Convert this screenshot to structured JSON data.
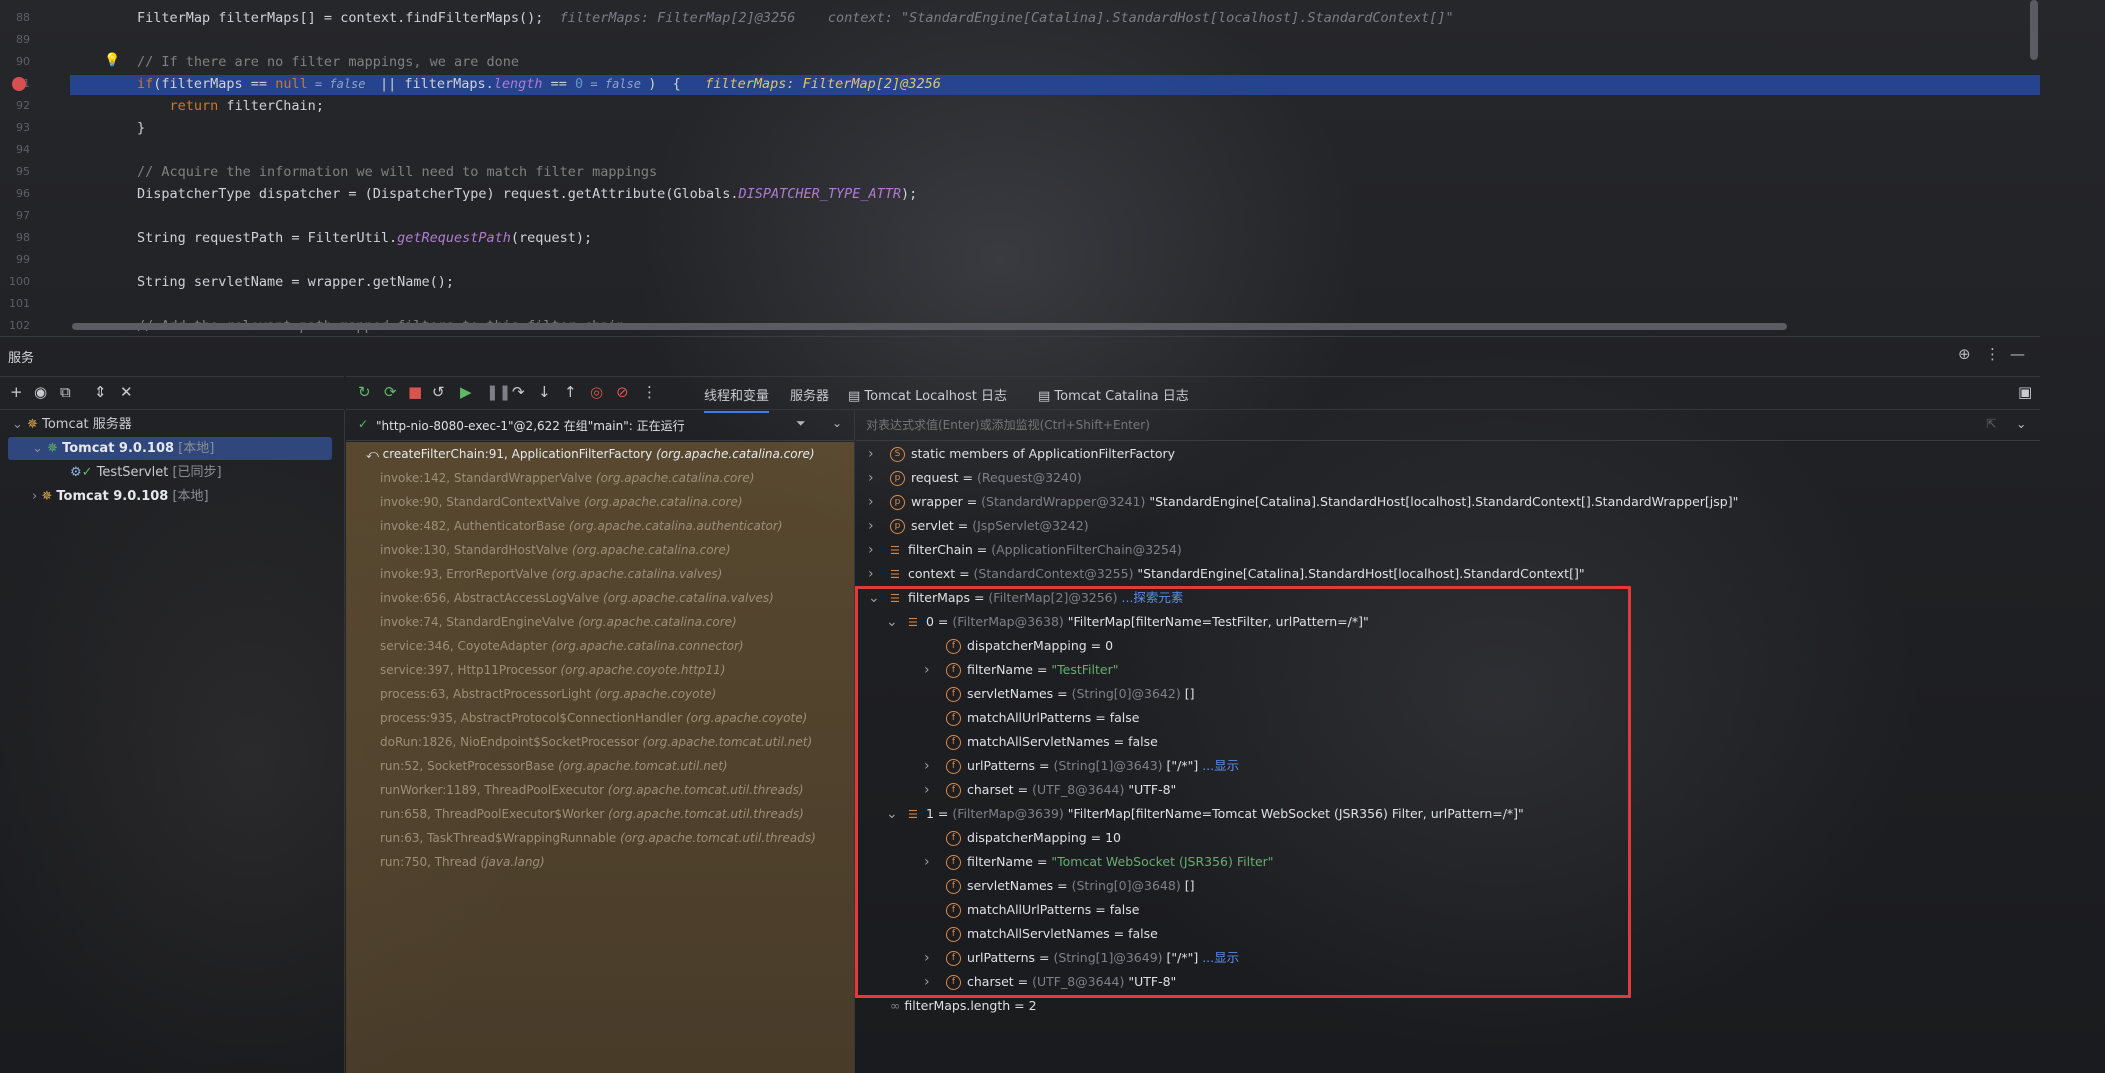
{
  "editor": {
    "lines": [
      {
        "num": "88",
        "html_segments": [
          [
            "",
            "FilterMap filterMaps[] = context.findFilterMaps();  "
          ],
          [
            "hint",
            "filterMaps: FilterMap[2]@3256    context: \"StandardEngine[Catalina].StandardHost[localhost].StandardContext[]\""
          ]
        ]
      },
      {
        "num": "89",
        "html_segments": []
      },
      {
        "num": "90",
        "html_segments": [
          [
            "cm",
            "// If there are no filter mappings, we are done"
          ]
        ]
      },
      {
        "num": "91",
        "html_segments": [
          [
            "kw",
            "if"
          ],
          [
            "",
            "(filterMaps == "
          ],
          [
            "kw",
            "null"
          ],
          [
            "inl-hint",
            " = false  "
          ],
          [
            "",
            "|| filterMaps."
          ],
          [
            "it",
            "length"
          ],
          [
            "",
            " == "
          ],
          [
            "num",
            "0"
          ],
          [
            "inl-hint",
            " = false "
          ],
          [
            "",
            ")  {   "
          ],
          [
            "fn",
            "filterMaps: FilterMap[2]@3256"
          ]
        ]
      },
      {
        "num": "92",
        "html_segments": [
          [
            "kw",
            "    return"
          ],
          [
            "",
            " filterChain;"
          ]
        ]
      },
      {
        "num": "93",
        "html_segments": [
          [
            "",
            "}"
          ]
        ]
      },
      {
        "num": "94",
        "html_segments": []
      },
      {
        "num": "95",
        "html_segments": [
          [
            "cm",
            "// Acquire the information we will need to match filter mappings"
          ]
        ]
      },
      {
        "num": "96",
        "html_segments": [
          [
            "",
            "DispatcherType dispatcher = (DispatcherType) request.getAttribute(Globals."
          ],
          [
            "it",
            "DISPATCHER_TYPE_ATTR"
          ],
          [
            "",
            ");"
          ]
        ]
      },
      {
        "num": "97",
        "html_segments": []
      },
      {
        "num": "98",
        "html_segments": [
          [
            "",
            "String requestPath = FilterUtil."
          ],
          [
            "it",
            "getRequestPath"
          ],
          [
            "",
            "(request);"
          ]
        ]
      },
      {
        "num": "99",
        "html_segments": []
      },
      {
        "num": "100",
        "html_segments": [
          [
            "",
            "String servletName = wrapper.getName();"
          ]
        ]
      },
      {
        "num": "101",
        "html_segments": []
      },
      {
        "num": "102",
        "html_segments": [
          [
            "cm",
            "// Add the relevant path-mapped filters to this filter chain"
          ]
        ]
      }
    ]
  },
  "services": {
    "title": "服务"
  },
  "tabs": {
    "threads": "线程和变量",
    "server": "服务器",
    "localhost_log": "Tomcat Localhost 日志",
    "catalina_log": "Tomcat Catalina 日志"
  },
  "tree": {
    "root": "Tomcat 服务器",
    "server1": "Tomcat 9.0.108",
    "server1_tag": "[本地]",
    "servlet": "TestServlet",
    "servlet_tag": "[已同步]",
    "server2": "Tomcat 9.0.108",
    "server2_tag": "[本地]"
  },
  "thread": {
    "label": "\"http-nio-8080-exec-1\"@2,622 在组\"main\": 正在运行"
  },
  "frames": [
    {
      "method": "createFilterChain:91, ApplicationFilterFactory",
      "pkg": "(org.apache.catalina.core)"
    },
    {
      "method": "invoke:142, StandardWrapperValve",
      "pkg": "(org.apache.catalina.core)"
    },
    {
      "method": "invoke:90, StandardContextValve",
      "pkg": "(org.apache.catalina.core)"
    },
    {
      "method": "invoke:482, AuthenticatorBase",
      "pkg": "(org.apache.catalina.authenticator)"
    },
    {
      "method": "invoke:130, StandardHostValve",
      "pkg": "(org.apache.catalina.core)"
    },
    {
      "method": "invoke:93, ErrorReportValve",
      "pkg": "(org.apache.catalina.valves)"
    },
    {
      "method": "invoke:656, AbstractAccessLogValve",
      "pkg": "(org.apache.catalina.valves)"
    },
    {
      "method": "invoke:74, StandardEngineValve",
      "pkg": "(org.apache.catalina.core)"
    },
    {
      "method": "service:346, CoyoteAdapter",
      "pkg": "(org.apache.catalina.connector)"
    },
    {
      "method": "service:397, Http11Processor",
      "pkg": "(org.apache.coyote.http11)"
    },
    {
      "method": "process:63, AbstractProcessorLight",
      "pkg": "(org.apache.coyote)"
    },
    {
      "method": "process:935, AbstractProtocol$ConnectionHandler",
      "pkg": "(org.apache.coyote)"
    },
    {
      "method": "doRun:1826, NioEndpoint$SocketProcessor",
      "pkg": "(org.apache.tomcat.util.net)"
    },
    {
      "method": "run:52, SocketProcessorBase",
      "pkg": "(org.apache.tomcat.util.net)"
    },
    {
      "method": "runWorker:1189, ThreadPoolExecutor",
      "pkg": "(org.apache.tomcat.util.threads)"
    },
    {
      "method": "run:658, ThreadPoolExecutor$Worker",
      "pkg": "(org.apache.tomcat.util.threads)"
    },
    {
      "method": "run:63, TaskThread$WrappingRunnable",
      "pkg": "(org.apache.tomcat.util.threads)"
    },
    {
      "method": "run:750, Thread",
      "pkg": "(java.lang)"
    }
  ],
  "eval": {
    "placeholder": "对表达式求值(Enter)或添加监视(Ctrl+Shift+Enter)"
  },
  "vars": {
    "static": {
      "name": "static",
      "rest": "members of ApplicationFilterFactory"
    },
    "request": {
      "name": "request",
      "type": "(Request@3240)"
    },
    "wrapper": {
      "name": "wrapper",
      "type": "(StandardWrapper@3241)",
      "value": "\"StandardEngine[Catalina].StandardHost[localhost].StandardContext[].StandardWrapper[jsp]\""
    },
    "servlet": {
      "name": "servlet",
      "type": "(JspServlet@3242)"
    },
    "filterChain": {
      "name": "filterChain",
      "type": "(ApplicationFilterChain@3254)"
    },
    "context": {
      "name": "context",
      "type": "(StandardContext@3255)",
      "value": "\"StandardEngine[Catalina].StandardHost[localhost].StandardContext[]\""
    },
    "filterMaps": {
      "name": "filterMaps",
      "type": "(FilterMap[2]@3256)",
      "link": "...探索元素"
    },
    "fm0": {
      "name": "0",
      "type": "(FilterMap@3638)",
      "value": "\"FilterMap[filterName=TestFilter, urlPattern=/*]\""
    },
    "fm0_fields": [
      {
        "name": "dispatcherMapping",
        "type": "",
        "value": "0",
        "str": false,
        "expand": false
      },
      {
        "name": "filterName",
        "type": "",
        "value": "\"TestFilter\"",
        "str": true,
        "expand": true
      },
      {
        "name": "servletNames",
        "type": "(String[0]@3642)",
        "value": "[]",
        "str": false,
        "expand": false
      },
      {
        "name": "matchAllUrlPatterns",
        "type": "",
        "value": "false",
        "str": false,
        "expand": false
      },
      {
        "name": "matchAllServletNames",
        "type": "",
        "value": "false",
        "str": false,
        "expand": false
      },
      {
        "name": "urlPatterns",
        "type": "(String[1]@3643)",
        "value": "[\"/*\"]",
        "link": "...显示",
        "str": false,
        "expand": true
      },
      {
        "name": "charset",
        "type": "(UTF_8@3644)",
        "value": "\"UTF-8\"",
        "str": false,
        "expand": true
      }
    ],
    "fm1": {
      "name": "1",
      "type": "(FilterMap@3639)",
      "value": "\"FilterMap[filterName=Tomcat WebSocket (JSR356) Filter, urlPattern=/*]\""
    },
    "fm1_fields": [
      {
        "name": "dispatcherMapping",
        "type": "",
        "value": "10",
        "str": false,
        "expand": false
      },
      {
        "name": "filterName",
        "type": "",
        "value": "\"Tomcat WebSocket (JSR356) Filter\"",
        "str": true,
        "expand": true
      },
      {
        "name": "servletNames",
        "type": "(String[0]@3648)",
        "value": "[]",
        "str": false,
        "expand": false
      },
      {
        "name": "matchAllUrlPatterns",
        "type": "",
        "value": "false",
        "str": false,
        "expand": false
      },
      {
        "name": "matchAllServletNames",
        "type": "",
        "value": "false",
        "str": false,
        "expand": false
      },
      {
        "name": "urlPatterns",
        "type": "(String[1]@3649)",
        "value": "[\"/*\"]",
        "link": "...显示",
        "str": false,
        "expand": true
      },
      {
        "name": "charset",
        "type": "(UTF_8@3644)",
        "value": "\"UTF-8\"",
        "str": false,
        "expand": true
      }
    ],
    "length": {
      "name": "filterMaps.length",
      "value": "2"
    }
  },
  "colors": {
    "accent": "#3d7cf0",
    "highlight_line": "#26489c",
    "annotation_box": "#e2393b",
    "string": "#6aab73",
    "keyword": "#cc7832"
  }
}
